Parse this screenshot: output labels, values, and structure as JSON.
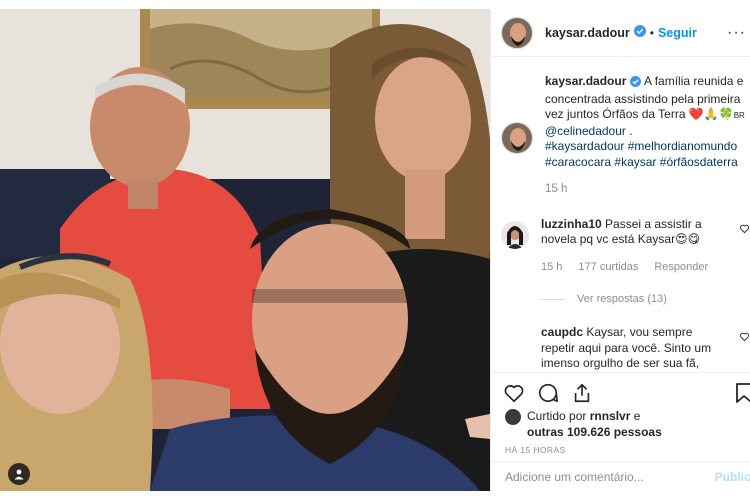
{
  "post": {
    "username": "kaysar.dadour",
    "follow_label": "Seguir",
    "dot": "•",
    "more_label": "···"
  },
  "caption": {
    "username": "kaysar.dadour",
    "text": " A família reunida e concentrada assistindo pela primeira vez juntos Órfãos da Terra ",
    "emoji": "❤️🙏🍀",
    "flag": "BR",
    "mention": "@celinedadour",
    "after_mention": " .",
    "hashtags": [
      "#kaysardadour",
      "#melhordianomundo",
      "#caracocara",
      "#kaysar",
      "#órfãosdaterra"
    ],
    "time": "15 h"
  },
  "comments": [
    {
      "username": "luzzinha10",
      "text": " Passei a assistir a novela pq vc está Kaysar😍😋",
      "time": "15 h",
      "likes": "177 curtidas",
      "reply_label": "Responder",
      "view_replies": "Ver respostas (13)"
    },
    {
      "username": "caupdc",
      "text": " Kaysar, vou sempre repetir aqui para você. Sinto um imenso orgulho de ser sua fã,"
    }
  ],
  "likes": {
    "prefix": "Curtido por ",
    "user": "rnnslvr",
    "connector": " e",
    "others": "outras 109.626 pessoas"
  },
  "time_ago": "HÁ 15 HORAS",
  "add_comment": {
    "placeholder": "Adicione um comentário...",
    "publish_label": "Publicar"
  },
  "icons": {
    "verified": "verified-badge-icon",
    "heart": "heart-icon",
    "comment": "comment-icon",
    "share": "share-icon",
    "bookmark": "bookmark-icon",
    "tag": "user-tag-icon"
  },
  "colors": {
    "link": "#00376b",
    "follow": "#0095f6",
    "muted": "#8e8e8e",
    "verified": "#3897f0",
    "publish_disabled": "#b2dffc"
  }
}
